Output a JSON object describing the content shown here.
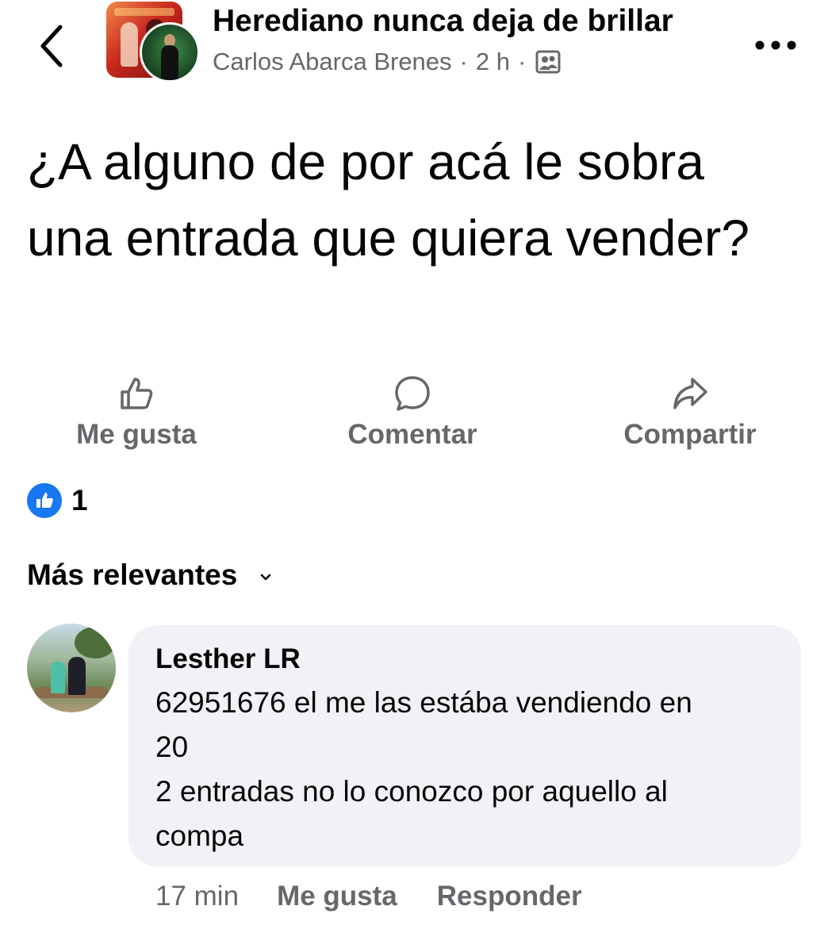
{
  "header": {
    "group_name": "Herediano nunca deja de brillar",
    "author": "Carlos Abarca Brenes",
    "separator": "·",
    "time": "2 h",
    "back_icon": "chevron-left-icon",
    "privacy_icon": "members-icon",
    "more_icon": "more-horizontal-icon"
  },
  "post": {
    "text": "¿A alguno de por acá le sobra una entrada que quiera vender?"
  },
  "actions": {
    "like_label": "Me gusta",
    "comment_label": "Comentar",
    "share_label": "Compartir"
  },
  "reactions": {
    "count": "1",
    "icon": "like-badge-icon",
    "color": "#1877f2"
  },
  "comments_sort": {
    "label": "Más relevantes"
  },
  "comment": {
    "author": "Lesther LR",
    "lines": [
      "62951676 el me las estába vendiendo en",
      "20",
      "2 entradas no lo conozco por aquello al",
      "compa"
    ],
    "time": "17 min",
    "like_label": "Me gusta",
    "reply_label": "Responder"
  },
  "colors": {
    "text_primary": "#050505",
    "text_secondary": "#65676b",
    "bubble_bg": "#f0f2f5",
    "accent": "#1877f2"
  }
}
